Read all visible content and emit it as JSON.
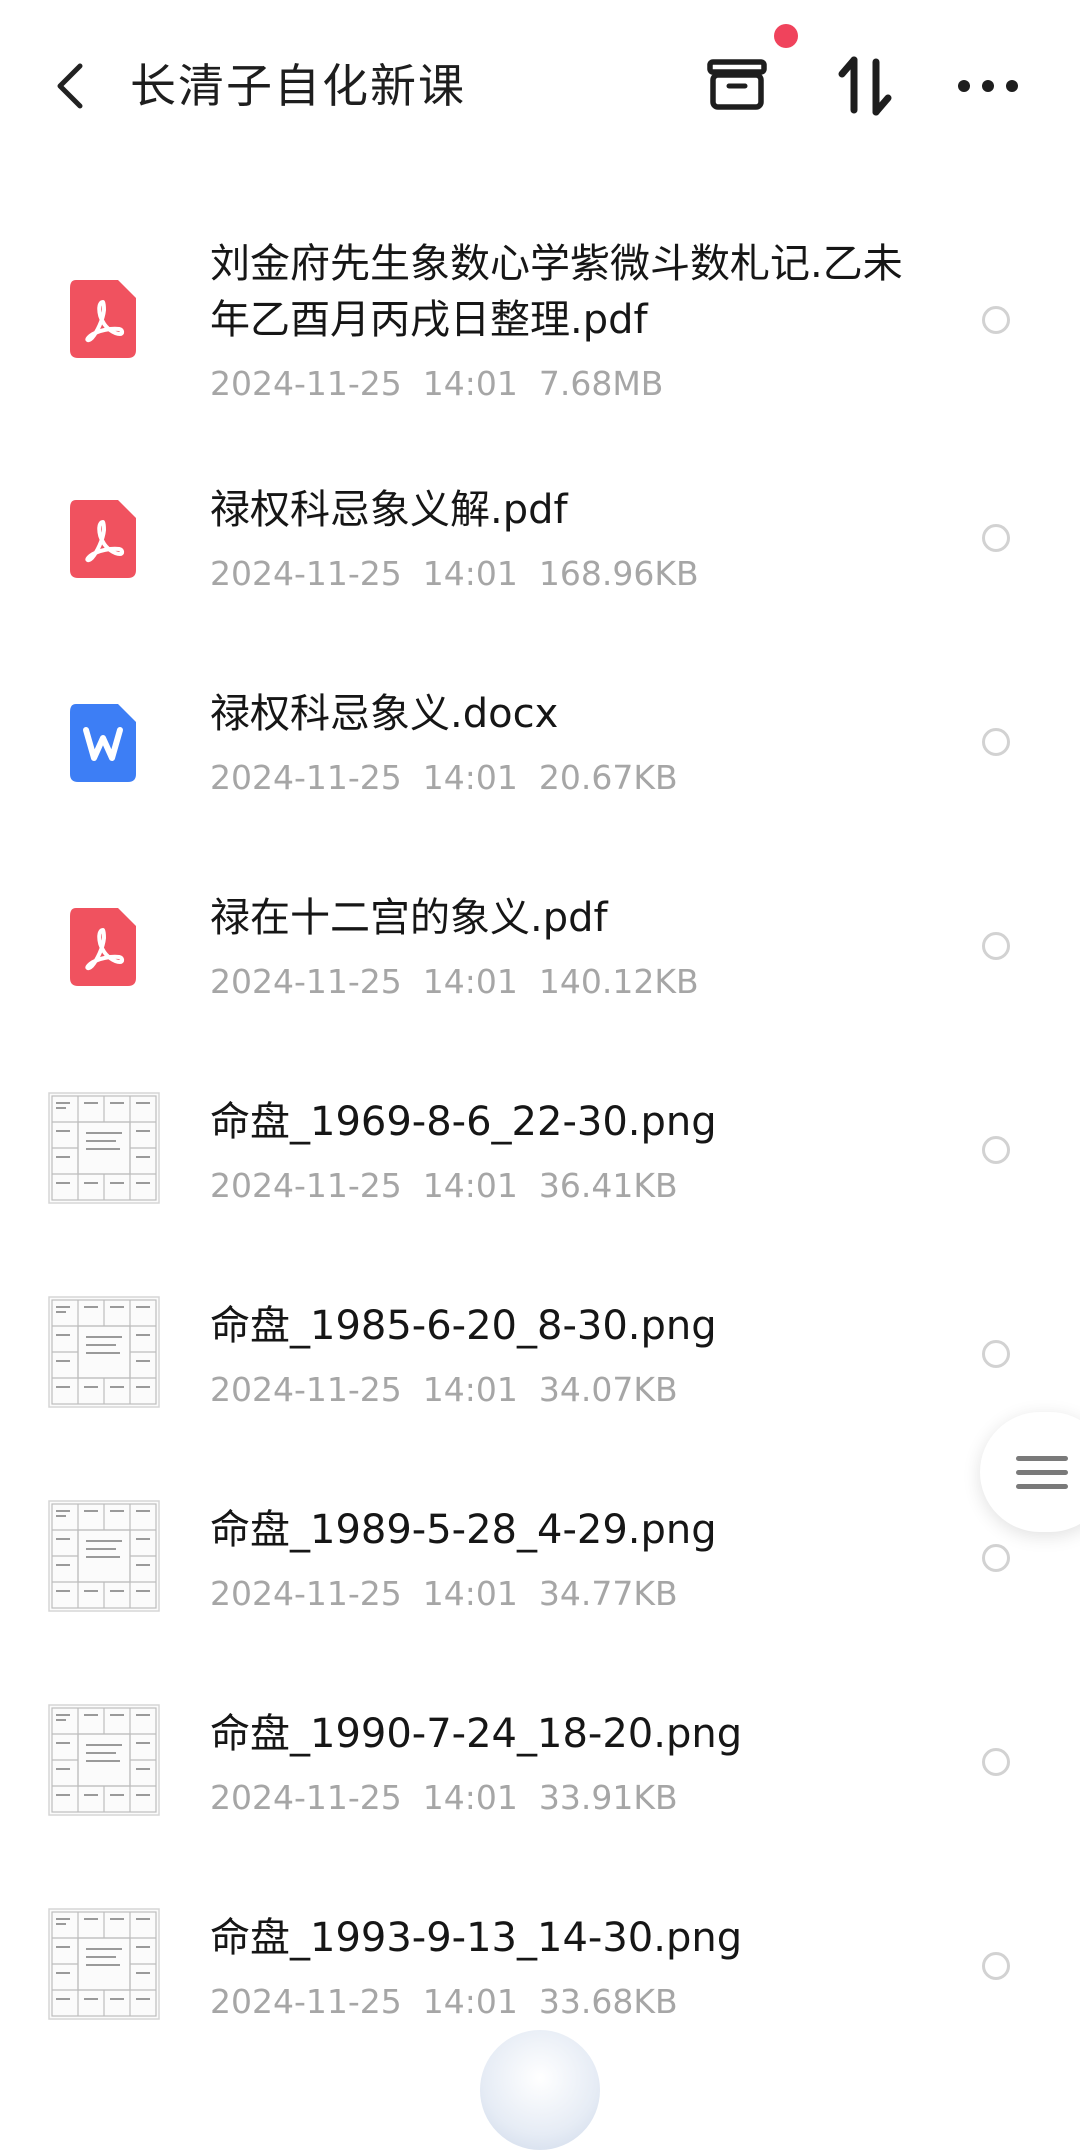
{
  "header": {
    "title": "长清子自化新课",
    "back_icon": "chevron-left-icon",
    "archive_icon": "archive-box-icon",
    "sort_icon": "sort-arrows-icon",
    "more_icon": "more-horizontal-icon",
    "notification_color": "#f0435c"
  },
  "colors": {
    "pdf": "#f0525f",
    "word": "#3d7ef5",
    "meta_text": "#a6a6a6"
  },
  "files": [
    {
      "type": "pdf",
      "name": "刘金府先生象数心学紫微斗数札记.乙未年乙酉月丙戌日整理.pdf",
      "date": "2024-11-25",
      "time": "14:01",
      "size": "7.68MB"
    },
    {
      "type": "pdf",
      "name": "禄权科忌象义解.pdf",
      "date": "2024-11-25",
      "time": "14:01",
      "size": "168.96KB"
    },
    {
      "type": "docx",
      "name": "禄权科忌象义.docx",
      "date": "2024-11-25",
      "time": "14:01",
      "size": "20.67KB"
    },
    {
      "type": "pdf",
      "name": "禄在十二宫的象义.pdf",
      "date": "2024-11-25",
      "time": "14:01",
      "size": "140.12KB"
    },
    {
      "type": "png",
      "name": "命盘_1969-8-6_22-30.png",
      "date": "2024-11-25",
      "time": "14:01",
      "size": "36.41KB"
    },
    {
      "type": "png",
      "name": "命盘_1985-6-20_8-30.png",
      "date": "2024-11-25",
      "time": "14:01",
      "size": "34.07KB"
    },
    {
      "type": "png",
      "name": "命盘_1989-5-28_4-29.png",
      "date": "2024-11-25",
      "time": "14:01",
      "size": "34.77KB"
    },
    {
      "type": "png",
      "name": "命盘_1990-7-24_18-20.png",
      "date": "2024-11-25",
      "time": "14:01",
      "size": "33.91KB"
    },
    {
      "type": "png",
      "name": "命盘_1993-9-13_14-30.png",
      "date": "2024-11-25",
      "time": "14:01",
      "size": "33.68KB"
    }
  ],
  "side_handle_icon": "menu-lines-icon"
}
